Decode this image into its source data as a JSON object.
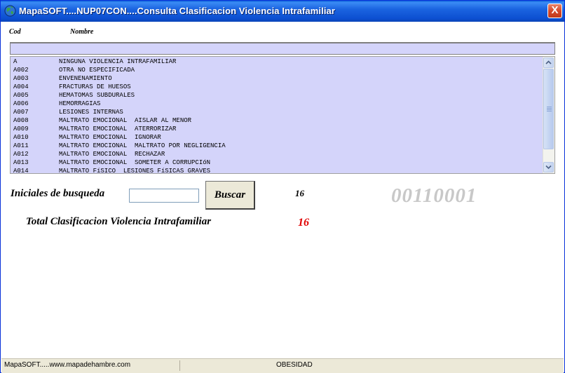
{
  "window": {
    "title": "MapaSOFT....NUP07CON....Consulta  Clasificacion Violencia Intrafamiliar",
    "close_glyph": "X",
    "icon": "globe-icon"
  },
  "list_header": {
    "cod": "Cod",
    "nombre": "Nombre"
  },
  "list": {
    "rows": [
      {
        "cod": "A",
        "nombre": "NINGUNA VIOLENCIA INTRAFAMILIAR"
      },
      {
        "cod": "A002",
        "nombre": "OTRA NO ESPECIFICADA"
      },
      {
        "cod": "A003",
        "nombre": "ENVENENAMIENTO"
      },
      {
        "cod": "A004",
        "nombre": "FRACTURAS DE HUESOS"
      },
      {
        "cod": "A005",
        "nombre": "HEMATOMAS SUBDURALES"
      },
      {
        "cod": "A006",
        "nombre": "HEMORRAGIAS"
      },
      {
        "cod": "A007",
        "nombre": "LESIONES INTERNAS"
      },
      {
        "cod": "A008",
        "nombre": "MALTRATO EMOCIONAL  AISLAR AL MENOR"
      },
      {
        "cod": "A009",
        "nombre": "MALTRATO EMOCIONAL  ATERRORIZAR"
      },
      {
        "cod": "A010",
        "nombre": "MALTRATO EMOCIONAL  IGNORAR"
      },
      {
        "cod": "A011",
        "nombre": "MALTRATO EMOCIONAL  MALTRATO POR NEGLIGENCIA"
      },
      {
        "cod": "A012",
        "nombre": "MALTRATO EMOCIONAL  RECHAZAR"
      },
      {
        "cod": "A013",
        "nombre": "MALTRATO EMOCIONAL  SOMETER A CORRUPCIóN"
      },
      {
        "cod": "A014",
        "nombre": "MALTRATO FíSICO  LESIONES FíSICAS GRAVES"
      }
    ]
  },
  "search": {
    "label": "Iniciales de busqueda",
    "value": "",
    "button_label": "Buscar",
    "result_count": "16"
  },
  "code_display": "00110001",
  "total": {
    "label": "Total  Clasificacion Violencia Intrafamiliar",
    "value": "16"
  },
  "statusbar": {
    "left": "MapaSOFT.....www.mapadehambre.com",
    "center": "OBESIDAD"
  },
  "colors": {
    "list_bg": "#d4d4fa",
    "total_value": "#e00000",
    "code_display": "#c8c8c8",
    "title_bar": "#0c4fd1"
  }
}
